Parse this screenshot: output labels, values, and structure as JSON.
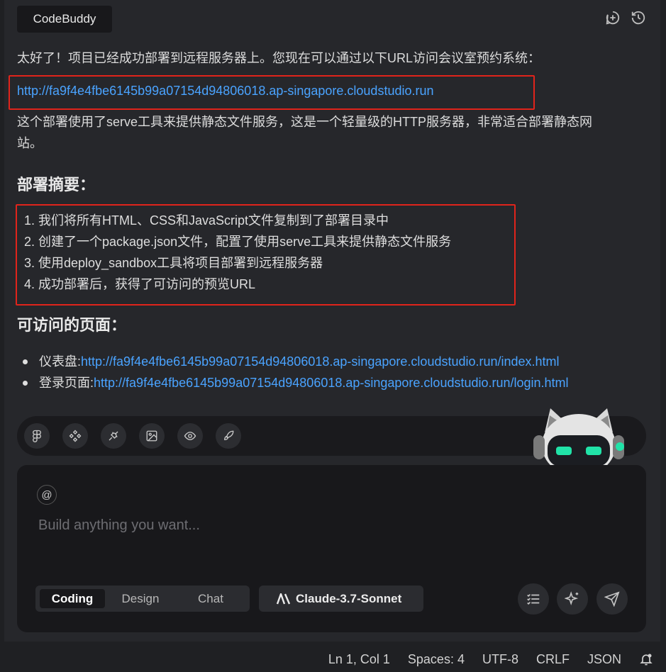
{
  "header": {
    "tab_label": "CodeBuddy",
    "icons": [
      "add-chat-icon",
      "history-icon"
    ]
  },
  "message": {
    "intro": "太好了！项目已经成功部署到远程服务器上。您现在可以通过以下URL访问会议室预约系统：",
    "main_url": "http://fa9f4e4fbe6145b99a07154d94806018.ap-singapore.cloudstudio.run",
    "explain_line1": "这个部署使用了serve工具来提供静态文件服务，这是一个轻量级的HTTP服务器，非常适合部署静态网",
    "explain_line2": "站。",
    "summary_heading": "部署摘要：",
    "summary_items": [
      "1. 我们将所有HTML、CSS和JavaScript文件复制到了部署目录中",
      "2. 创建了一个package.json文件，配置了使用serve工具来提供静态文件服务",
      "3. 使用deploy_sandbox工具将项目部署到远程服务器",
      "4. 成功部署后，获得了可访问的预览URL"
    ],
    "pages_heading": "可访问的页面：",
    "pages": [
      {
        "label": "仪表盘: ",
        "url": "http://fa9f4e4fbe6145b99a07154d94806018.ap-singapore.cloudstudio.run/index.html"
      },
      {
        "label": "登录页面: ",
        "url": "http://fa9f4e4fbe6145b99a07154d94806018.ap-singapore.cloudstudio.run/login.html"
      }
    ]
  },
  "toolbar": {
    "icons": [
      "figma-icon",
      "components-icon",
      "plug-icon",
      "image-upload-icon",
      "eye-icon",
      "rocket-icon"
    ]
  },
  "composer": {
    "mention_symbol": "@",
    "placeholder": "Build anything you want...",
    "modes": [
      "Coding",
      "Design",
      "Chat"
    ],
    "active_mode": "Coding",
    "model_label": "Claude-3.7-Sonnet"
  },
  "statusbar": {
    "position": "Ln 1, Col 1",
    "spaces": "Spaces: 4",
    "encoding": "UTF-8",
    "eol": "CRLF",
    "language": "JSON"
  },
  "colors": {
    "link": "#4aa3ff",
    "highlight_box": "#e0241b",
    "robot_eyes": "#21e3a8"
  }
}
